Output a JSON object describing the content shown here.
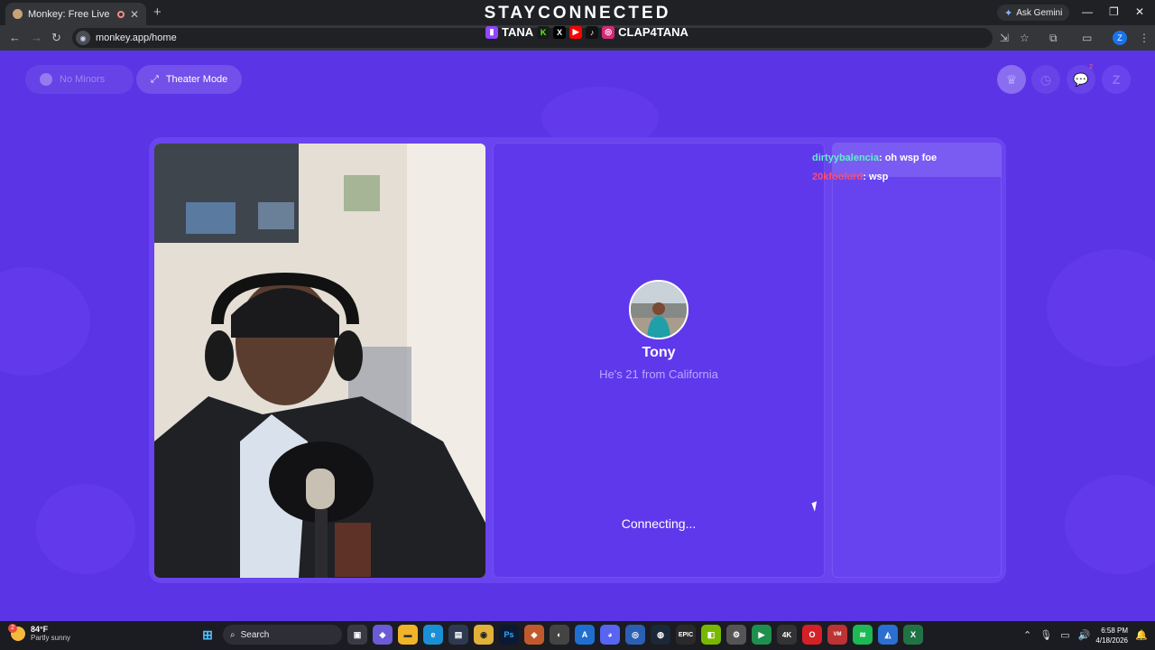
{
  "browser": {
    "tab_title": "Monkey: Free Live Video Ch",
    "tab_close": "✕",
    "new_tab": "+",
    "ask_gemini": "Ask Gemini",
    "url": "monkey.app/home",
    "profile_initial": "Z",
    "window_minimize": "—",
    "window_restore": "❐",
    "window_close": "✕"
  },
  "overlay": {
    "title": "STAYCONNECTED",
    "handle_primary": "TANA",
    "handle_secondary": "CLAP4TANA"
  },
  "page": {
    "no_minors_label": "No Minors",
    "theater_mode_label": "Theater Mode",
    "user_initial": "Z",
    "chat_badge": "2",
    "partner": {
      "name": "Tony",
      "info": "He's 21 from California",
      "status": "Connecting..."
    },
    "chat": [
      {
        "user": "dirtyybalencia",
        "message": ": oh wsp foe"
      },
      {
        "user": "20kfoolurd",
        "message": ": wsp"
      }
    ]
  },
  "taskbar": {
    "weather_temp": "84°F",
    "weather_desc": "Partly sunny",
    "weather_badge": "2",
    "search_label": "Search",
    "time": "6:58 PM",
    "date": "4/18/2026"
  },
  "colors": {
    "page_bg": "#5b34e6",
    "card_bg": "#6a44ef",
    "chat_user_1": "#5ff0c8",
    "chat_user_2": "#ff4d6a"
  }
}
